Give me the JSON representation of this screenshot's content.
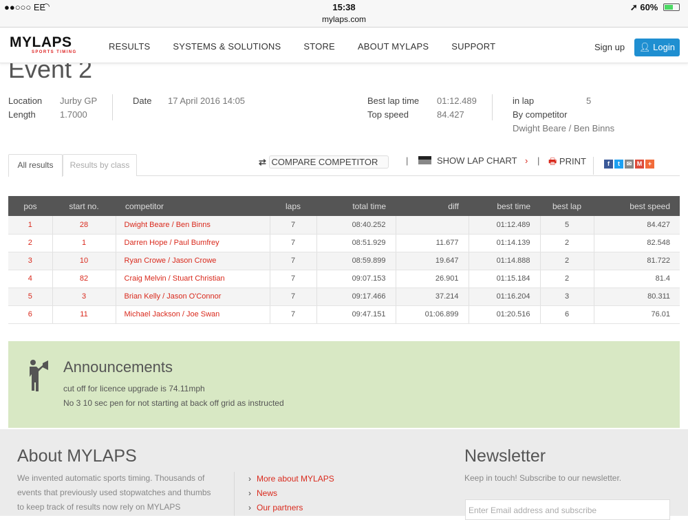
{
  "status": {
    "carrier": "●●○○○ EE",
    "time": "15:38",
    "url": "mylaps.com",
    "battery": "60%",
    "battery_level": 0.6
  },
  "nav": {
    "logo": "MYLAPS",
    "logo_sub": "SPORTS TIMING",
    "items": [
      "RESULTS",
      "SYSTEMS & SOLUTIONS",
      "STORE",
      "ABOUT MYLAPS",
      "SUPPORT"
    ],
    "signup": "Sign up",
    "login": "Login"
  },
  "event": {
    "title": "Event 2",
    "location_label": "Location",
    "location": "Jurby GP",
    "length_label": "Length",
    "length": "1.7000",
    "date_label": "Date",
    "date": "17 April 2016 14:05",
    "best_lap_time_label": "Best lap time",
    "best_lap_time": "01:12.489",
    "top_speed_label": "Top speed",
    "top_speed": "84.427",
    "in_lap_label": "in lap",
    "in_lap": "5",
    "by_competitor_label": "By competitor",
    "by_competitor": "Dwight Beare / Ben Binns"
  },
  "tabs": {
    "all": "All results",
    "by_class": "Results by class"
  },
  "tools": {
    "compare": "COMPARE COMPETITOR",
    "lap_chart": "SHOW LAP CHART",
    "print": "PRINT"
  },
  "table": {
    "headers": [
      "pos",
      "start no.",
      "competitor",
      "laps",
      "total time",
      "diff",
      "best time",
      "best lap",
      "best speed"
    ],
    "rows": [
      [
        "1",
        "28",
        "Dwight Beare / Ben Binns",
        "7",
        "08:40.252",
        "",
        "01:12.489",
        "5",
        "84.427"
      ],
      [
        "2",
        "1",
        "Darren Hope / Paul Bumfrey",
        "7",
        "08:51.929",
        "11.677",
        "01:14.139",
        "2",
        "82.548"
      ],
      [
        "3",
        "10",
        "Ryan Crowe / Jason Crowe",
        "7",
        "08:59.899",
        "19.647",
        "01:14.888",
        "2",
        "81.722"
      ],
      [
        "4",
        "82",
        "Craig Melvin / Stuart Christian",
        "7",
        "09:07.153",
        "26.901",
        "01:15.184",
        "2",
        "81.4"
      ],
      [
        "5",
        "3",
        "Brian Kelly / Jason O'Connor",
        "7",
        "09:17.466",
        "37.214",
        "01:16.204",
        "3",
        "80.311"
      ],
      [
        "6",
        "11",
        "Michael Jackson / Joe Swan",
        "7",
        "09:47.151",
        "01:06.899",
        "01:20.516",
        "6",
        "76.01"
      ]
    ]
  },
  "announcements": {
    "title": "Announcements",
    "lines": [
      "cut off for licence upgrade is 74.11mph",
      "No 3 10 sec pen for not starting at back off grid as instructed"
    ]
  },
  "footer": {
    "about_title": "About MYLAPS",
    "about_text": [
      "We invented automatic sports timing. Thousands of",
      "events that previously used stopwatches and thumbs",
      "to keep track of results now rely on MYLAPS"
    ],
    "links": [
      "More about MYLAPS",
      "News",
      "Our partners"
    ],
    "newsletter_title": "Newsletter",
    "newsletter_text": "Keep in touch! Subscribe to our newsletter.",
    "email_placeholder": "Enter Email address and subscribe"
  },
  "colors": {
    "accent_red": "#d9291c",
    "login_blue": "#1f8fd1",
    "announce_bg": "#d8e8c4",
    "table_header": "#555555"
  }
}
